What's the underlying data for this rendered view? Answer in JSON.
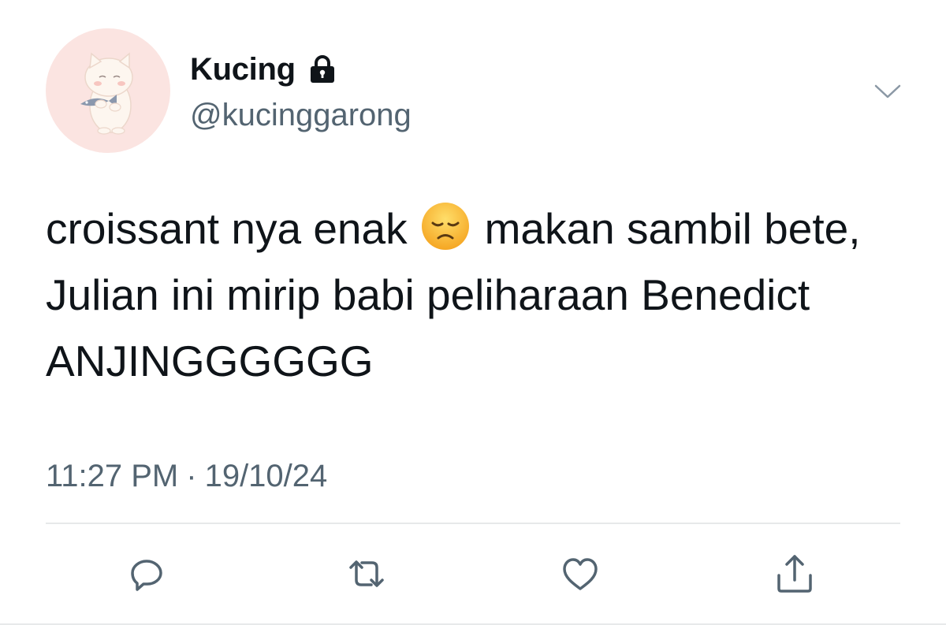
{
  "user": {
    "display_name": "Kucing",
    "handle": "@kucinggarong",
    "avatar_icon": "cat-holding-fish-avatar",
    "protected_icon": "lock-icon"
  },
  "tweet": {
    "text_part1": "croissant nya enak",
    "emoji": "disappointed-face-emoji",
    "text_part2": "makan sambil bete, Julian ini mirip babi peliharaan Benedict ANJINGGGGGG",
    "time": "11:27 PM",
    "separator": "·",
    "date": "19/10/24"
  },
  "actions": {
    "reply_icon": "reply-icon",
    "retweet_icon": "retweet-icon",
    "like_icon": "heart-icon",
    "share_icon": "share-icon",
    "more_icon": "chevron-down-icon"
  },
  "colors": {
    "text": "#0f1419",
    "secondary": "#536471",
    "icon": "#536471",
    "divider": "#e7e9ea",
    "avatar_bg": "#fbe4e1"
  }
}
